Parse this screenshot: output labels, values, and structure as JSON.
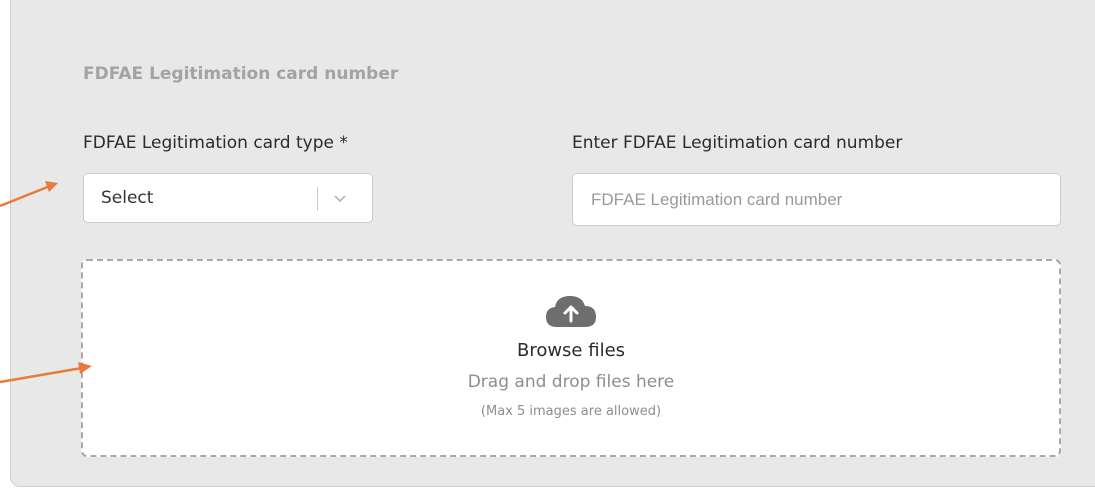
{
  "section": {
    "title": "FDFAE Legitimation card number"
  },
  "card_type": {
    "label": "FDFAE Legitimation card type *",
    "selected": "Select"
  },
  "card_number": {
    "label": "Enter FDFAE Legitimation card number",
    "placeholder": "FDFAE Legitimation card number",
    "value": ""
  },
  "upload": {
    "browse_label": "Browse files",
    "drag_text": "Drag and drop files here",
    "limit_text": "(Max 5 images are allowed)"
  },
  "icons": {
    "dropdown": "chevron-down-icon",
    "upload": "cloud-upload-icon",
    "annotation": "arrow-icon"
  },
  "colors": {
    "panel_bg": "#e8e8e8",
    "annotation_arrow": "#e87b3a"
  }
}
